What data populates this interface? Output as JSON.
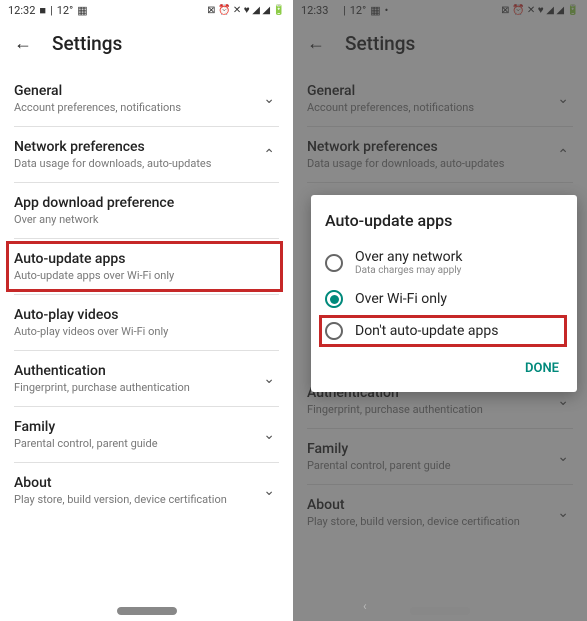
{
  "left": {
    "status": {
      "time": "12:32",
      "temp": "12°"
    },
    "header": {
      "title": "Settings"
    },
    "sections": [
      {
        "title": "General",
        "sub": "Account preferences, notifications",
        "chev": "⌄"
      },
      {
        "title": "Network preferences",
        "sub": "Data usage for downloads, auto-updates",
        "chev": "⌃"
      },
      {
        "title": "App download preference",
        "sub": "Over any network",
        "chev": ""
      },
      {
        "title": "Auto-update apps",
        "sub": "Auto-update apps over Wi-Fi only",
        "chev": ""
      },
      {
        "title": "Auto-play videos",
        "sub": "Auto-play videos over Wi-Fi only",
        "chev": ""
      },
      {
        "title": "Authentication",
        "sub": "Fingerprint, purchase authentication",
        "chev": "⌄"
      },
      {
        "title": "Family",
        "sub": "Parental control, parent guide",
        "chev": "⌄"
      },
      {
        "title": "About",
        "sub": "Play store, build version, device certification",
        "chev": "⌄"
      }
    ]
  },
  "right": {
    "status": {
      "time": "12:33",
      "temp": "12°"
    },
    "header": {
      "title": "Settings"
    },
    "sections": [
      {
        "title": "General",
        "sub": "Account preferences, notifications",
        "chev": "⌄"
      },
      {
        "title": "Network preferences",
        "sub": "Data usage for downloads, auto-updates",
        "chev": "⌃"
      },
      {
        "title": "Authentication",
        "sub": "Fingerprint, purchase authentication",
        "chev": "⌄"
      },
      {
        "title": "Family",
        "sub": "Parental control, parent guide",
        "chev": "⌄"
      },
      {
        "title": "About",
        "sub": "Play store, build version, device certification",
        "chev": "⌄"
      }
    ],
    "dialog": {
      "title": "Auto-update apps",
      "options": [
        {
          "label": "Over any network",
          "sub": "Data charges may apply"
        },
        {
          "label": "Over Wi-Fi only",
          "sub": ""
        },
        {
          "label": "Don't auto-update apps",
          "sub": ""
        }
      ],
      "done": "DONE"
    }
  }
}
